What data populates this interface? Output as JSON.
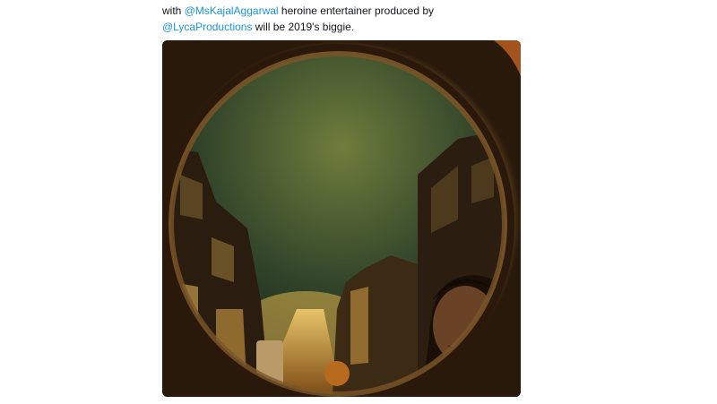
{
  "tweet": {
    "text_prefix": "with ",
    "mention_1": "@MsKajalAggarwal",
    "text_middle": " heroine entertainer produced by ",
    "mention_2": "@LycaProductions",
    "text_suffix": " will be 2019's biggie."
  },
  "photo": {
    "alt": "Night street scene framed through a round porthole with a man's face in the lower right"
  },
  "colors": {
    "mention": "#1b95e0",
    "text": "#14171a",
    "sky_top": "#0f1f17",
    "sky_bottom": "#6f7d3c",
    "frame": "#2b1a0c"
  },
  "icons": {
    "frame": "porthole-frame"
  }
}
